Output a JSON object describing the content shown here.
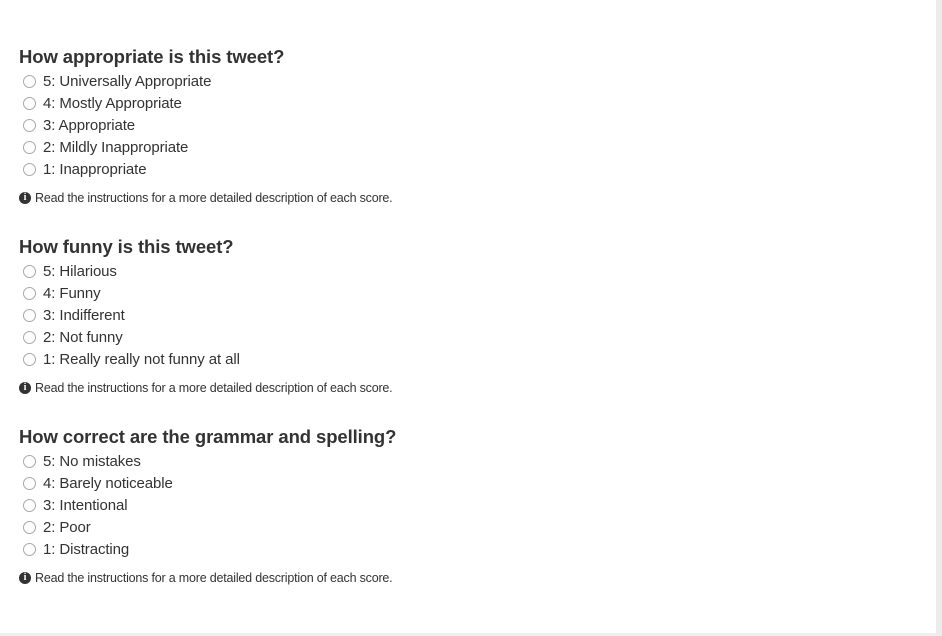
{
  "help_icon": "info-circle-icon",
  "questions": [
    {
      "title": "How appropriate is this tweet?",
      "options": [
        "5: Universally Appropriate",
        "4: Mostly Appropriate",
        "3: Appropriate",
        "2: Mildly Inappropriate",
        "1: Inappropriate"
      ],
      "help_text": "Read the instructions for a more detailed description of each score."
    },
    {
      "title": "How funny is this tweet?",
      "options": [
        "5: Hilarious",
        "4: Funny",
        "3: Indifferent",
        "2: Not funny",
        "1: Really really not funny at all"
      ],
      "help_text": "Read the instructions for a more detailed description of each score."
    },
    {
      "title": "How correct are the grammar and spelling?",
      "options": [
        "5: No mistakes",
        "4: Barely noticeable",
        "3: Intentional",
        "2: Poor",
        "1: Distracting"
      ],
      "help_text": "Read the instructions for a more detailed description of each score."
    }
  ]
}
